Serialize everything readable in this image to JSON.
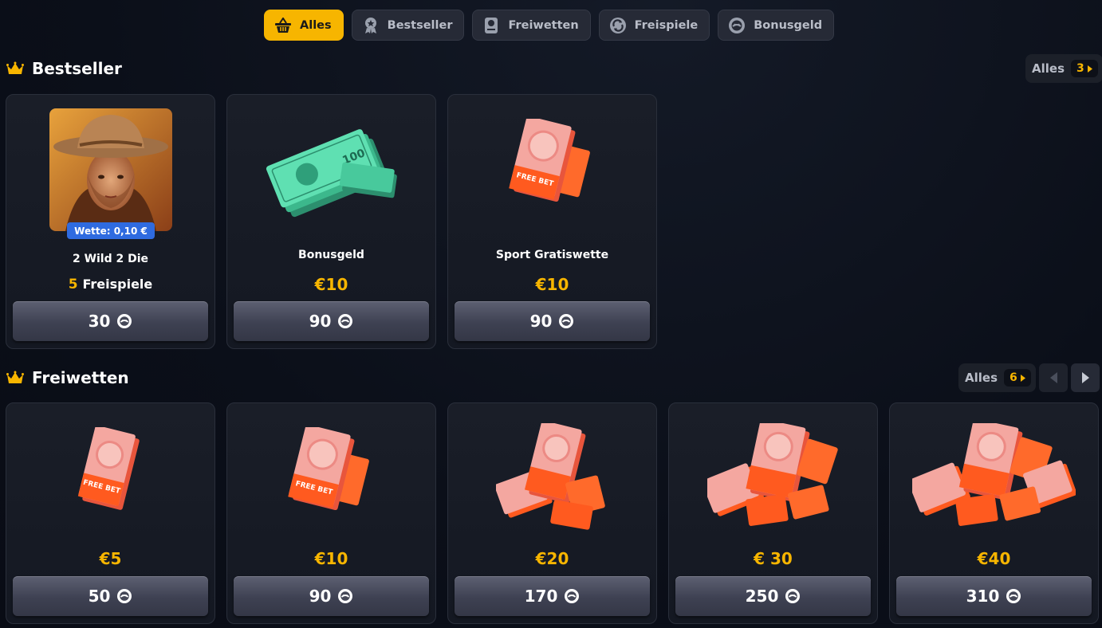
{
  "tabs": [
    {
      "label": "Alles",
      "icon": "basket-icon",
      "active": true
    },
    {
      "label": "Bestseller",
      "icon": "medal-icon",
      "active": false
    },
    {
      "label": "Freiwetten",
      "icon": "ticket-icon",
      "active": false
    },
    {
      "label": "Freispiele",
      "icon": "spin-icon",
      "active": false
    },
    {
      "label": "Bonusgeld",
      "icon": "coin-icon",
      "active": false
    }
  ],
  "sections": {
    "bestseller": {
      "title": "Bestseller",
      "alles_label": "Alles",
      "count": "3",
      "cards": [
        {
          "name": "2 Wild 2 Die",
          "badge": "Wette: 0,10 €",
          "value_num": "5",
          "value_text": "Freispiele",
          "price": "30"
        },
        {
          "name": "Bonusgeld",
          "value": "€10",
          "price": "90"
        },
        {
          "name": "Sport Gratiswette",
          "value": "€10",
          "price": "90"
        }
      ]
    },
    "freiwetten": {
      "title": "Freiwetten",
      "alles_label": "Alles",
      "count": "6",
      "cards": [
        {
          "value": "€5",
          "price": "50"
        },
        {
          "value": "€10",
          "price": "90"
        },
        {
          "value": "€20",
          "price": "170"
        },
        {
          "value": "€ 30",
          "price": "250"
        },
        {
          "value": "€40",
          "price": "310"
        }
      ]
    }
  },
  "colors": {
    "accent": "#f7b500",
    "badge": "#2f6be0",
    "background": "#0b0f19"
  },
  "ticket_text": "FREE BET",
  "banknote_text": "100"
}
